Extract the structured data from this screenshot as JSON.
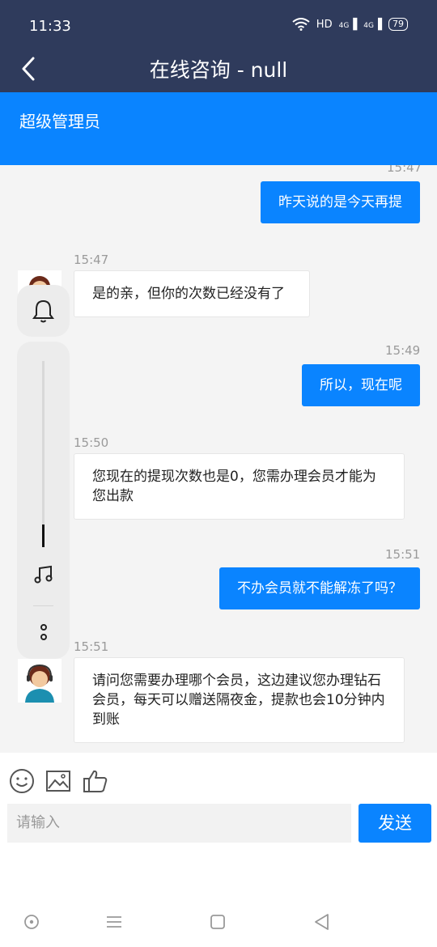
{
  "status_bar": {
    "time": "11:33",
    "network": "HD",
    "signal1": "4G",
    "signal2": "4G",
    "battery": "79"
  },
  "header": {
    "title": "在线咨询 - null"
  },
  "agent": {
    "name": "超级管理员"
  },
  "messages": [
    {
      "side": "out",
      "time": "15:47",
      "text": "昨天说的是今天再提"
    },
    {
      "side": "in",
      "time": "15:47",
      "text": "是的亲，但你的次数已经没有了"
    },
    {
      "side": "out",
      "time": "15:49",
      "text": "所以，现在呢"
    },
    {
      "side": "in",
      "time": "15:50",
      "text": "您现在的提现次数也是0，您需办理会员才能为您出款"
    },
    {
      "side": "out",
      "time": "15:51",
      "text": "不办会员就不能解冻了吗？"
    },
    {
      "side": "in",
      "time": "15:51",
      "text": "请问您需要办理哪个会员，这边建议您办理钻石会员，每天可以赠送隔夜金，提款也会10分钟内到账"
    }
  ],
  "composer": {
    "placeholder": "请输入",
    "send_label": "发送"
  },
  "icons": [
    "emoji-icon",
    "image-icon",
    "thumbs-up-icon",
    "bell-icon",
    "music-icon",
    "more-icon"
  ],
  "colors": {
    "header": "#2f3b5c",
    "accent": "#0a84ff",
    "chat_bg": "#f4f4f4"
  }
}
